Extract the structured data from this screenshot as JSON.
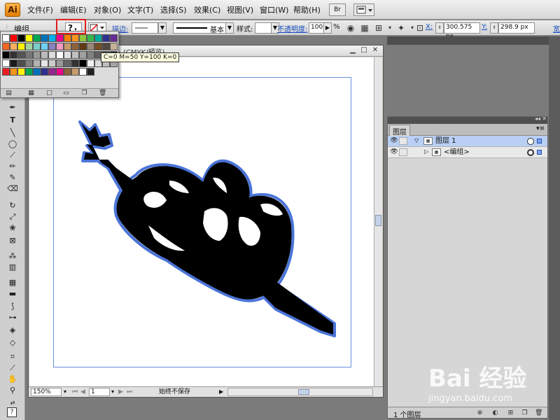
{
  "app": {
    "logo": "Ai"
  },
  "menu": {
    "items": [
      "文件(F)",
      "编辑(E)",
      "对象(O)",
      "文字(T)",
      "选择(S)",
      "效果(C)",
      "视图(V)",
      "窗口(W)",
      "帮助(H)"
    ],
    "bridge_label": "Br"
  },
  "control_bar": {
    "selection_label": "编组",
    "fill_symbol": "?",
    "stroke_label": "描边:",
    "stroke_style": "基本",
    "style_label": "样式:",
    "opacity_label": "不透明度:",
    "opacity_value": "100",
    "opacity_unit": "%",
    "x_label": "X:",
    "x_value": "300.575 px",
    "y_label": "Y:",
    "y_value": "298.9 px",
    "width_label": "宽:"
  },
  "swatch_panel": {
    "tooltip": "C=0 M=50 Y=100 K=0",
    "rows": [
      [
        "#ffffff",
        "#ff0000",
        "#000000",
        "#ffff00",
        "#00a651",
        "#0072bc",
        "#00aeef",
        "#ec008c",
        "#ff7f00",
        "#f7941d",
        "#8dc63f",
        "#39b54a",
        "#00a99d",
        "#2e3192",
        "#662d91"
      ],
      [
        "#f26522",
        "#fbaf5d",
        "#fff200",
        "#a3d39c",
        "#7accc8",
        "#6dcff6",
        "#8781bd",
        "#f49ac1",
        "#c69c6d",
        "#8c6239",
        "#603913",
        "#998675",
        "#754c24",
        "#534741",
        "#c7b299"
      ],
      [
        "#000000",
        "#333333",
        "#555555",
        "#777777",
        "#999999",
        "#bbbbbb",
        "#dddddd",
        "#ffffff",
        "#e0e0e0",
        "#c0c0c0",
        "#a0a0a0",
        "#808080",
        "#606060",
        "#404040",
        "#202020"
      ],
      [
        "#ffffff",
        "#1a1a1a",
        "#4d4d4d",
        "#808080",
        "#b3b3b3",
        "#e6e6e6",
        "#cccccc",
        "#999999",
        "#666666",
        "#333333",
        "#000000",
        "#f2f2f2",
        "#d9d9d9",
        "#bfbfbf",
        "#a6a6a6"
      ],
      [
        "#ed1c24",
        "#f7941d",
        "#fff200",
        "#00a651",
        "#0072bc",
        "#2e3192",
        "#92278f",
        "#ec008c",
        "#8c6239",
        "#c69c6d",
        "#ffffff",
        "#231f20"
      ]
    ]
  },
  "document": {
    "title": "@ 150% (CMYK/预览)",
    "zoom": "150%",
    "page": "1",
    "status": "始终不保存"
  },
  "layers_panel": {
    "tab": "图层",
    "rows": [
      {
        "name": "图层 1",
        "expanded": true,
        "selected": true
      },
      {
        "name": "<编组>",
        "expanded": false,
        "selected": false
      }
    ],
    "footer_count": "1 个图层"
  },
  "colors": {
    "artwork_fill": "#000000",
    "artwork_outline": "#4a74d8",
    "artboard_border": "#6b8ed6",
    "highlight": "#e02020",
    "layer_selected": "#b9cff4"
  },
  "watermark": {
    "text": "Bai 经验",
    "url": "jingyan.baidu.com"
  }
}
